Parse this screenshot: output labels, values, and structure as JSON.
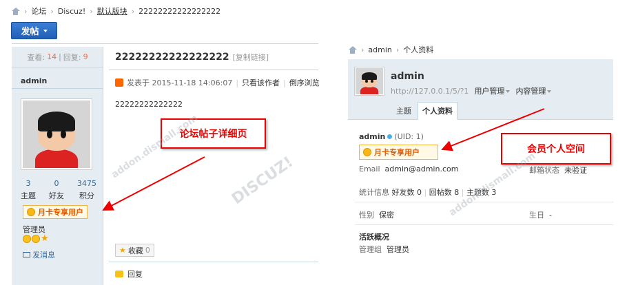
{
  "forum": {
    "breadcrumb": [
      "论坛",
      "Discuz!",
      "默认版块",
      "22222222222222222"
    ],
    "post_button": "发帖",
    "stats": {
      "view_label": "查看:",
      "views": "14",
      "sep": "|",
      "reply_label": "回复:",
      "replies": "9"
    },
    "author": "admin",
    "user_stats": [
      {
        "value": "3",
        "label": "主题"
      },
      {
        "value": "0",
        "label": "好友"
      },
      {
        "value": "3475",
        "label": "积分"
      }
    ],
    "vip_badge": "月卡专享用户",
    "group": "管理员",
    "send_message": "发消息",
    "thread_title": "22222222222222222",
    "copy_link": "[复制链接]",
    "post_meta": {
      "posted": "发表于 2015-11-18 14:06:07",
      "only_author": "只看该作者",
      "reverse": "倒序浏览"
    },
    "post_content": "22222222222222",
    "favorite": {
      "label": "收藏",
      "count": "0"
    },
    "reply": "回复"
  },
  "annotations": {
    "left_label": "论坛帖子详细页",
    "right_label": "会员个人空间"
  },
  "space": {
    "breadcrumb": [
      "admin",
      "个人资料"
    ],
    "name": "admin",
    "url": "http://127.0.0.1/5/?1",
    "menus": [
      "用户管理",
      "内容管理"
    ],
    "tabs": [
      "主题",
      "个人资料"
    ],
    "uid_name": "admin",
    "uid": "(UID: 1)",
    "vip_badge": "月卡专享用户",
    "email_label": "Email",
    "email": "admin@admin.com",
    "mail_status_label": "邮箱状态",
    "mail_status": "未验证",
    "stats_label": "统计信息",
    "stats": [
      "好友数 0",
      "回帖数 8",
      "主题数 3"
    ],
    "gender_label": "性别",
    "gender": "保密",
    "birthday_label": "生日",
    "birthday": "-",
    "activity_title": "活跃概况",
    "group_label": "管理组",
    "group": "管理员"
  },
  "watermark": "DISCUZ!应用中心 | 贰道 addon.dismall.com",
  "colors": {
    "accent": "#1f5fb5",
    "annotation": "#e00000",
    "link": "#336699"
  }
}
